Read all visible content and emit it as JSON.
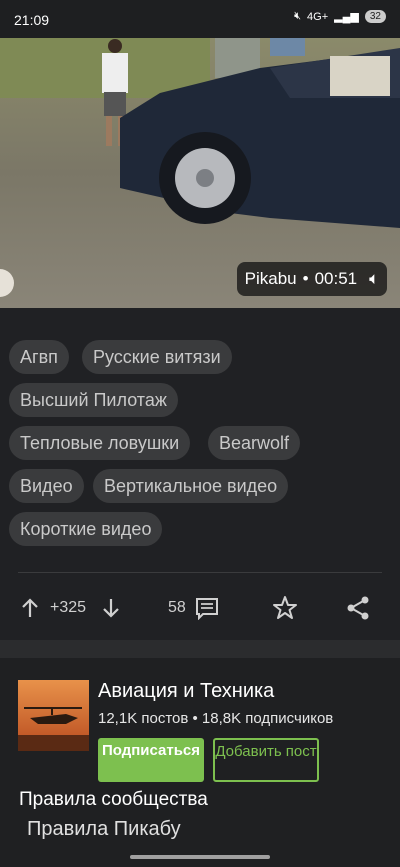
{
  "status_bar": {
    "time": "21:09",
    "network": "4G+",
    "battery": "32"
  },
  "video": {
    "source": "Pikabu",
    "duration": "00:51"
  },
  "tags": [
    "Агвп",
    "Русские витязи",
    "Высший Пилотаж",
    "Тепловые ловушки",
    "Bearwolf",
    "Видео",
    "Вертикальное видео",
    "Короткие видео"
  ],
  "actions": {
    "rating": "+325",
    "comments": "58"
  },
  "community": {
    "name": "Авиация и Техника",
    "stats": "12,1K постов • 18,8K подписчиков",
    "subscribe_label": "Подписаться",
    "add_post_label": "Добавить пост",
    "rules_title": "Правила сообщества",
    "rules_item": "Правила Пикабу"
  },
  "colors": {
    "accent": "#7dc04f",
    "background": "#202124",
    "tag_bg": "#3a3b3d"
  }
}
